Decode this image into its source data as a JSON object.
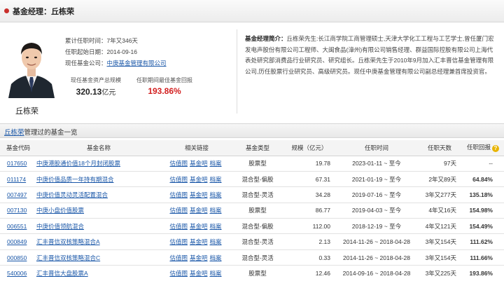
{
  "header": {
    "title": "基金经理：丘栋荣"
  },
  "manager": {
    "name": "丘栋荣",
    "tenure_label": "累计任职时间：",
    "tenure": "7年又346天",
    "start_label": "任职起始日期：",
    "start_date": "2014-09-16",
    "company_label": "现任基金公司：",
    "company": "中庚基金管理有限公司",
    "stat1_label": "现任基金资产总规模",
    "stat1_value": "320.13",
    "stat1_unit": "亿元",
    "stat2_label": "任职期间最佳基金回报",
    "stat2_value": "193.86%",
    "bio_label": "基金经理简介：",
    "bio_text": "丘栋荣先生:长江商学院工商管理硕士,天津大学化工工程与工艺学士,曾任厦门宏发电声股份有限公司工程师、大闽食品(漳州)有限公司销售经理、群益国际控股有限公司上海代表处研究部消费品行业研究员、研究组长。丘栋荣先生于2010年9月加入汇丰晋信基金管理有限公司,历任股票行业研究员、高级研究员。现任中庚基金管理有限公司副总经理兼首席投资官。"
  },
  "section": {
    "name_link": "丘栋荣",
    "title_rest": "管理过的基金一览"
  },
  "table": {
    "headers": [
      "基金代码",
      "基金名称",
      "相关链接",
      "基金类型",
      "规模（亿元）",
      "任职时间",
      "任职天数",
      "任职回报"
    ],
    "link_labels": [
      "估值图",
      "基金吧",
      "档案"
    ],
    "rows": [
      {
        "code": "017650",
        "name": "中庚港股通价值18个月封闭股票",
        "type": "股票型",
        "size": "19.78",
        "period": "2023-01-11 ~ 至今",
        "days": "97天",
        "ret": "--"
      },
      {
        "code": "011174",
        "name": "中庚价值品质一年持有期混合",
        "type": "混合型-偏股",
        "size": "67.31",
        "period": "2021-01-19 ~ 至今",
        "days": "2年又89天",
        "ret": "64.84%"
      },
      {
        "code": "007497",
        "name": "中庚价值灵动灵活配置混合",
        "type": "混合型-灵活",
        "size": "34.28",
        "period": "2019-07-16 ~ 至今",
        "days": "3年又277天",
        "ret": "135.18%"
      },
      {
        "code": "007130",
        "name": "中庚小盘价值股票",
        "type": "股票型",
        "size": "86.77",
        "period": "2019-04-03 ~ 至今",
        "days": "4年又16天",
        "ret": "154.98%"
      },
      {
        "code": "006551",
        "name": "中庚价值领航混合",
        "type": "混合型-偏股",
        "size": "112.00",
        "period": "2018-12-19 ~ 至今",
        "days": "4年又121天",
        "ret": "154.49%"
      },
      {
        "code": "000849",
        "name": "汇丰晋信双核策略混合A",
        "type": "混合型-灵活",
        "size": "2.13",
        "period": "2014-11-26 ~ 2018-04-28",
        "days": "3年又154天",
        "ret": "111.62%"
      },
      {
        "code": "000850",
        "name": "汇丰晋信双核策略混合C",
        "type": "混合型-灵活",
        "size": "0.33",
        "period": "2014-11-26 ~ 2018-04-28",
        "days": "3年又154天",
        "ret": "111.66%"
      },
      {
        "code": "540006",
        "name": "汇丰晋信大盘股票A",
        "type": "股票型",
        "size": "12.46",
        "period": "2014-09-16 ~ 2018-04-28",
        "days": "3年又225天",
        "ret": "193.86%"
      }
    ]
  }
}
